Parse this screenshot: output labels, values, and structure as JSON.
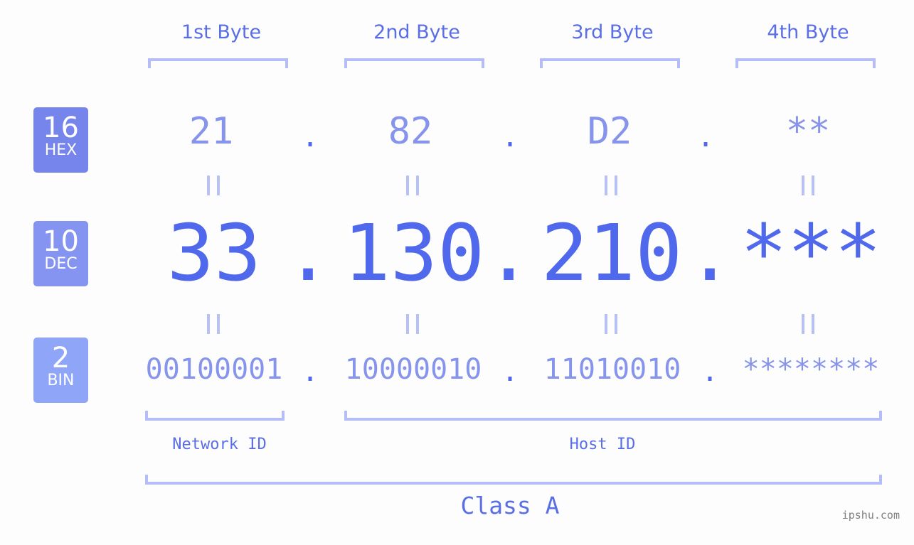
{
  "headers": [
    "1st Byte",
    "2nd Byte",
    "3rd Byte",
    "4th Byte"
  ],
  "badges": {
    "hex": {
      "base": "16",
      "label": "HEX",
      "color": "#7585ec"
    },
    "dec": {
      "base": "10",
      "label": "DEC",
      "color": "#8594f1"
    },
    "bin": {
      "base": "2",
      "label": "BIN",
      "color": "#8fa5f8"
    }
  },
  "hex": [
    "21",
    "82",
    "D2",
    "**"
  ],
  "dec": [
    "33",
    "130",
    "210",
    "***"
  ],
  "bin": [
    "00100001",
    "10000010",
    "11010010",
    "********"
  ],
  "separator": ".",
  "network_label": "Network ID",
  "host_label": "Host ID",
  "class_label": "Class A",
  "watermark": "ipshu.com",
  "colors": {
    "accent": "#5068ec",
    "light": "#8794ec",
    "bracket": "#b4bdf8"
  }
}
